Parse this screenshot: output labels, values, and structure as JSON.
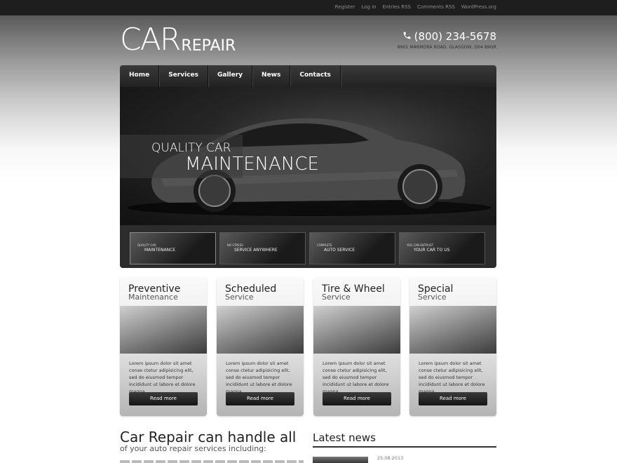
{
  "top_links": [
    "Register",
    "Log in",
    "Entries RSS",
    "Comments RSS",
    "WordPress.org"
  ],
  "logo": {
    "big": "CAR",
    "small": "REPAIR"
  },
  "contact": {
    "phone": "(800) 234-5678",
    "address": "8901 MARMORA ROAD, GLASGOW, D04 89GR",
    "phone_icon": "phone-icon"
  },
  "nav": [
    "Home",
    "Services",
    "Gallery",
    "News",
    "Contacts"
  ],
  "hero": {
    "line1": "QUALITY CAR",
    "line2": "MAINTENANCE"
  },
  "thumbs": [
    {
      "t1": "QUALITY CAR",
      "t2": "MAINTENANCE"
    },
    {
      "t1": "NO STRESS",
      "t2": "SERVICE ANYWHERE"
    },
    {
      "t1": "COMPLETE",
      "t2": "AUTO SERVICE"
    },
    {
      "t1": "YOU CAN ENTRUST",
      "t2": "YOUR CAR TO US"
    }
  ],
  "cards": [
    {
      "title": "Preventive",
      "subtitle": "Maintenance",
      "desc": "Lorem ipsum dolor sit amet conse ctetur adipisicing elit, sed do eiusmod tempor incididunt ut labore et dolore magna",
      "button": "Read more"
    },
    {
      "title": "Scheduled",
      "subtitle": "Service",
      "desc": "Lorem ipsum dolor sit amet conse ctetur adipisicing elit, sed do eiusmod tempor incididunt ut labore et dolore magna",
      "button": "Read more"
    },
    {
      "title": "Tire & Wheel",
      "subtitle": "Service",
      "desc": "Lorem ipsum dolor sit amet conse ctetur adipisicing elit, sed do eiusmod tempor incididunt ut labore et dolore magna",
      "button": "Read more"
    },
    {
      "title": "Special",
      "subtitle": "Service",
      "desc": "Lorem ipsum dolor sit amet conse ctetur adipisicing elit, sed do eiusmod tempor incididunt ut labore et dolore magna",
      "button": "Read more"
    }
  ],
  "bottom": {
    "heading": "Car Repair can handle all",
    "subheading": "of your auto repair services including:",
    "news_heading": "Latest news",
    "news_date": "25.08.2013"
  }
}
